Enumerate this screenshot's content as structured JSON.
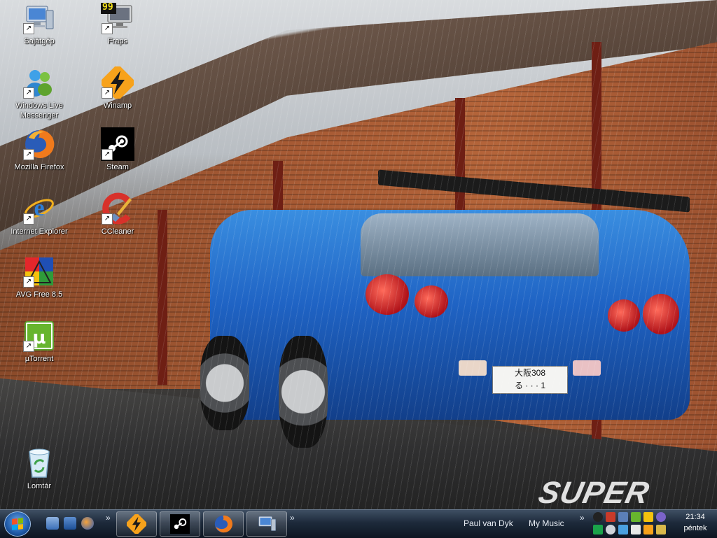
{
  "desktop": {
    "icons": [
      {
        "label": "Sajátgép"
      },
      {
        "label": "Fraps",
        "badge": "99"
      },
      {
        "label": "Windows Live Messenger"
      },
      {
        "label": "Winamp"
      },
      {
        "label": "Mozilla Firefox"
      },
      {
        "label": "Steam"
      },
      {
        "label": "Internet Explorer"
      },
      {
        "label": "CCleaner"
      },
      {
        "label": "AVG Free 8.5"
      },
      {
        "label": "µTorrent"
      },
      {
        "label": "Lomtár"
      }
    ],
    "shortcut_arrow": "↗"
  },
  "wallpaper": {
    "plate_top": "大阪308",
    "plate_bottom": "る · · · 1",
    "watermark": "SUPER STREET"
  },
  "taskbar": {
    "chevron": "»",
    "now_playing_artist": "Paul van Dyk",
    "toolbar_label": "My Music",
    "clock_time": "21:34",
    "clock_day": "péntek"
  },
  "colors": {
    "taskbar_top": "#3f4f63",
    "taskbar_bottom": "#0d1521",
    "car_blue": "#1f63c4"
  }
}
